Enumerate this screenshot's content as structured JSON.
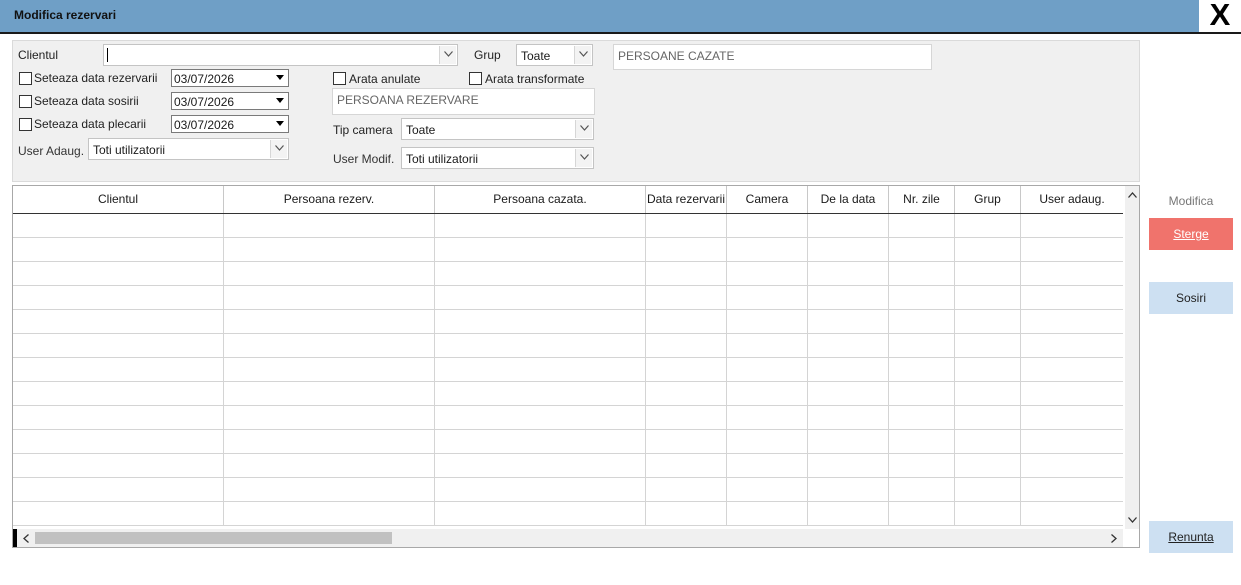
{
  "window": {
    "title": "Modifica rezervari",
    "close_label": "X"
  },
  "filters": {
    "client_label": "Clientul",
    "client_value": "",
    "grup_label": "Grup",
    "grup_value": "Toate",
    "persoane_cazate_placeholder": "PERSOANE CAZATE",
    "rezervare": {
      "label": "Seteaza data rezervarii",
      "checked": false,
      "date": "03/07/2026"
    },
    "sosire": {
      "label": "Seteaza data sosirii",
      "checked": false,
      "date": "03/07/2026"
    },
    "plecare": {
      "label": "Seteaza data plecarii",
      "checked": false,
      "date": "03/07/2026"
    },
    "arata_anulate": {
      "label": "Arata anulate",
      "checked": false
    },
    "arata_transformate": {
      "label": "Arata transformate",
      "checked": false
    },
    "persoana_rezervare_placeholder": "PERSOANA REZERVARE",
    "tip_camera_label": "Tip camera",
    "tip_camera_value": "Toate",
    "user_adaug_label": "User Adaug.",
    "user_adaug_value": "Toti utilizatorii",
    "user_modif_label": "User Modif.",
    "user_modif_value": "Toti utilizatorii"
  },
  "grid": {
    "columns": [
      "Clientul",
      "Persoana rezerv.",
      "Persoana cazata.",
      "Data rezervarii",
      "Camera",
      "De la data",
      "Nr. zile",
      "Grup",
      "User adaug."
    ],
    "rows": []
  },
  "actions": {
    "modifica": "Modifica",
    "sterge": "Sterge",
    "sosiri": "Sosiri",
    "renunta": "Renunta"
  },
  "colors": {
    "titlebar": "#6f9fc6",
    "delete": "#f0736c",
    "button": "#cde0f2"
  }
}
